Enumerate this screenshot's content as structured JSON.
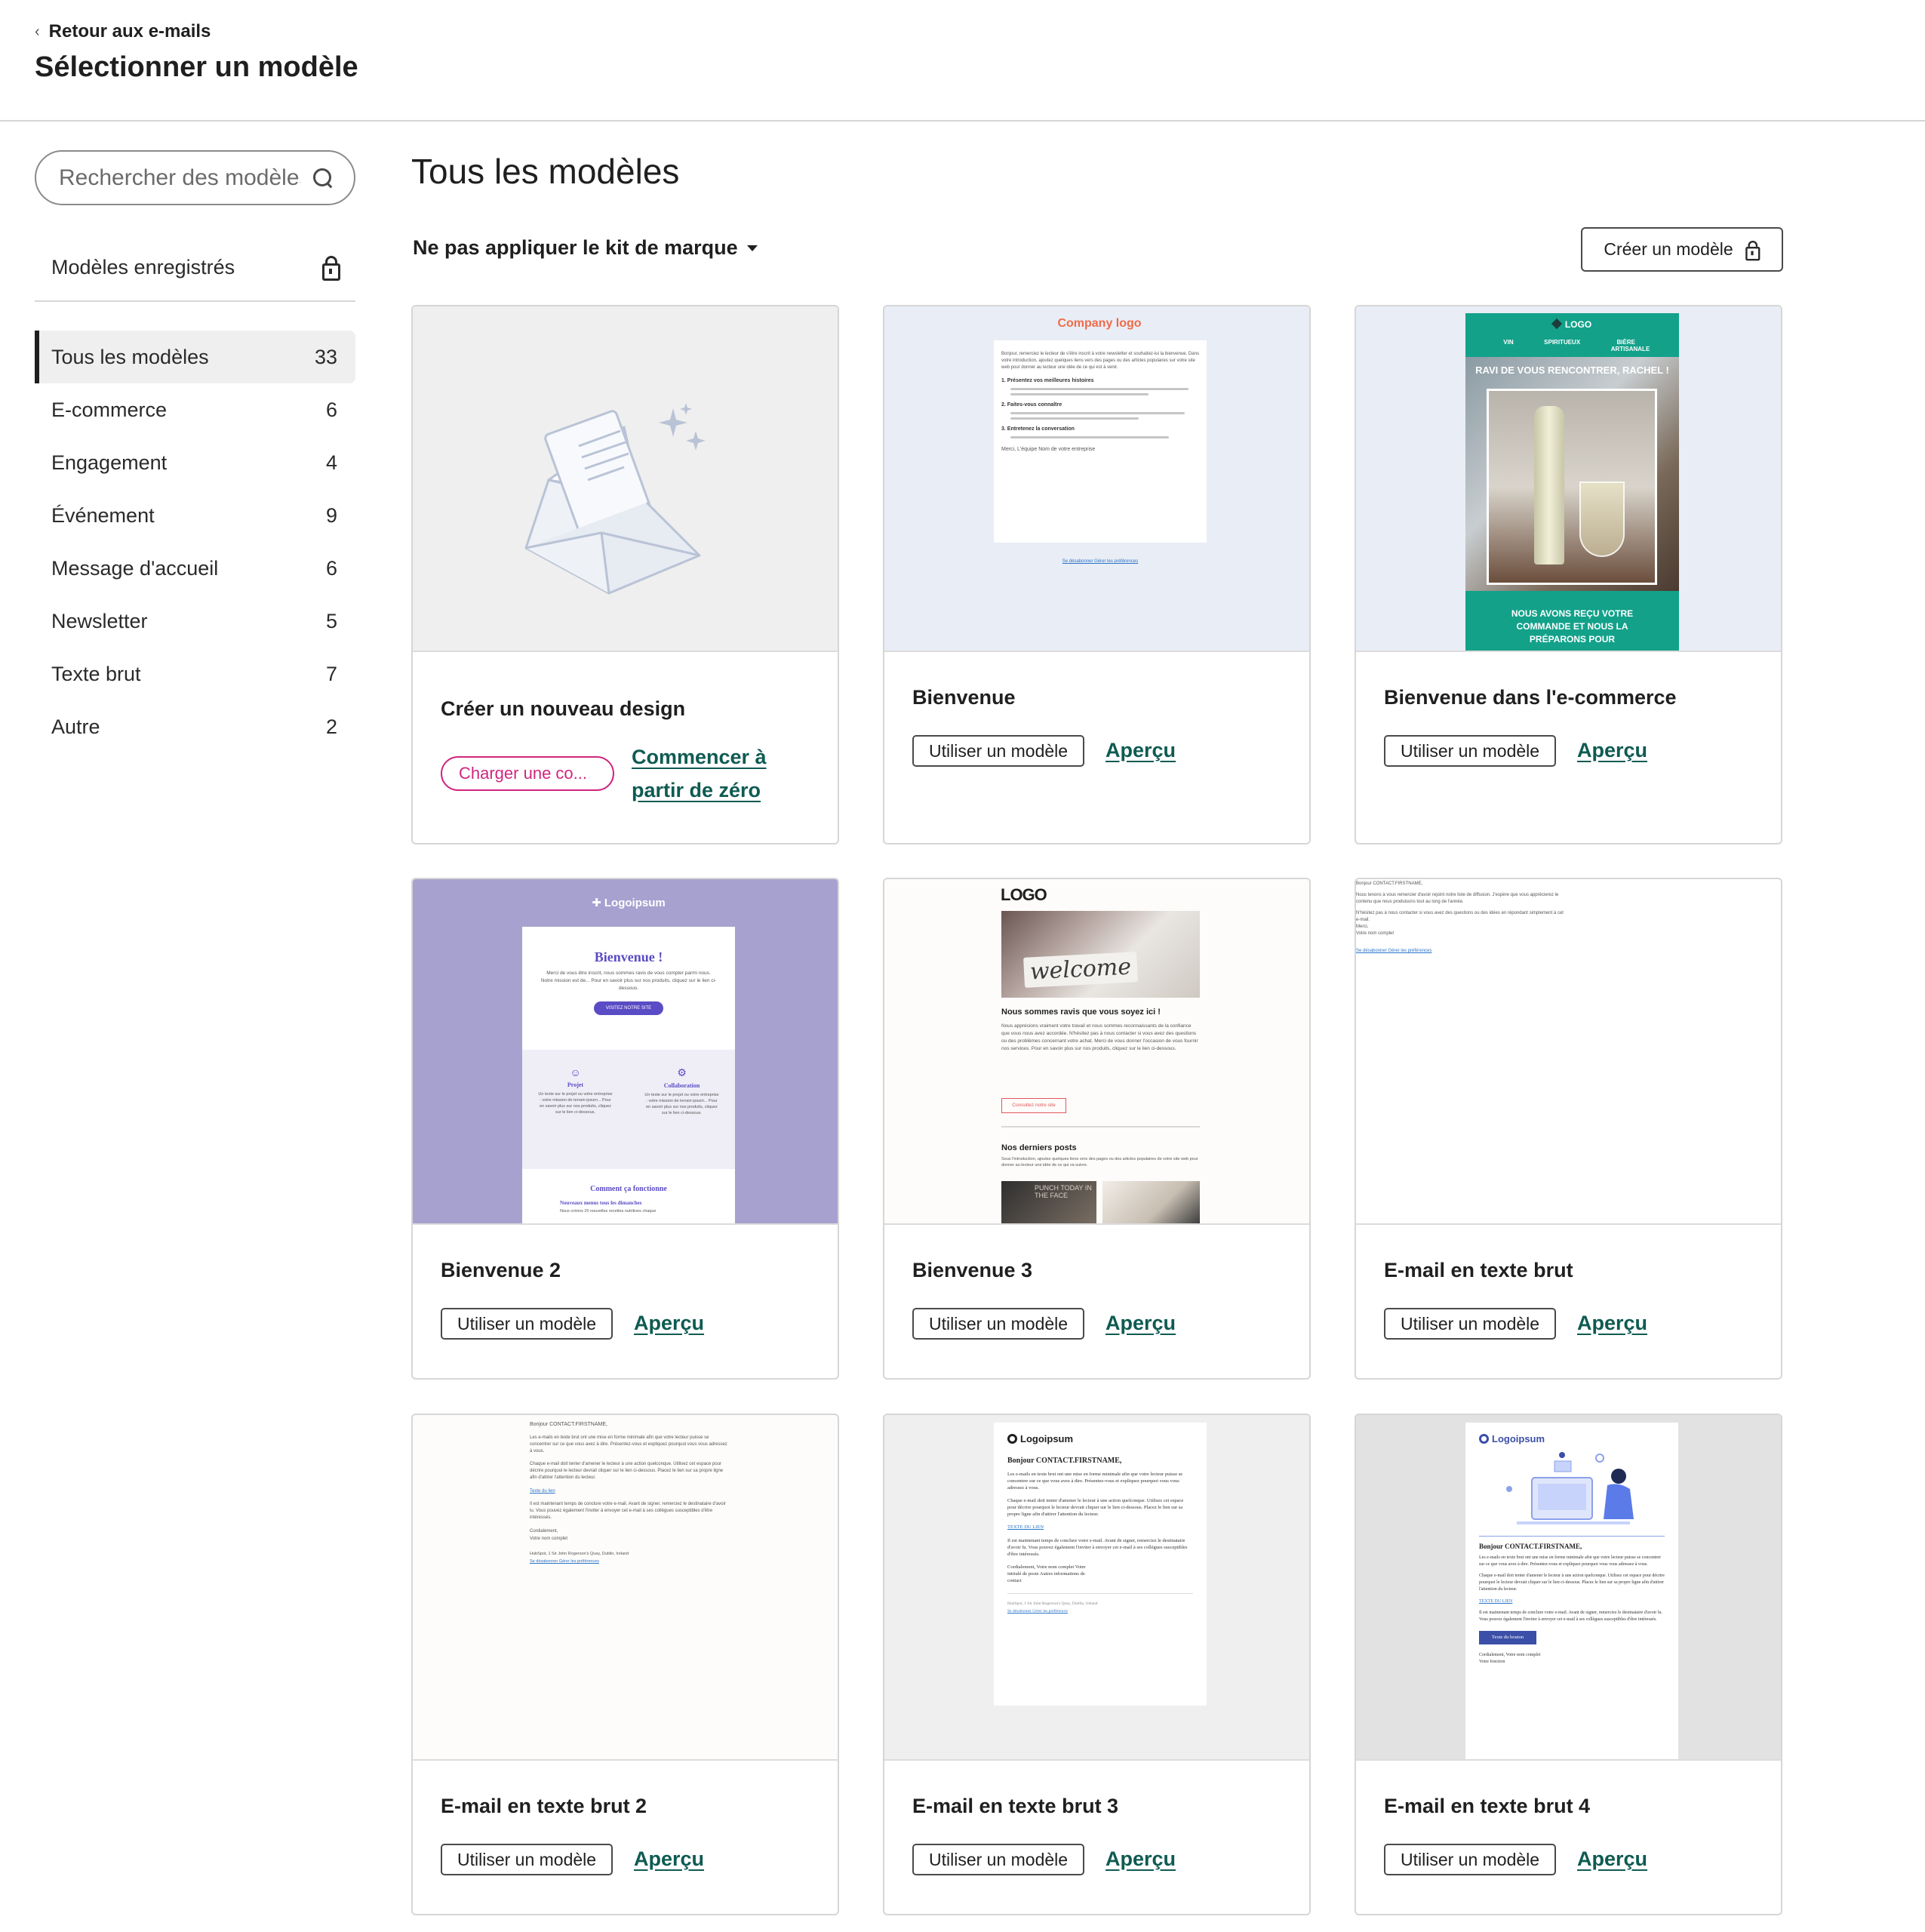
{
  "header": {
    "back_label": "Retour aux e-mails",
    "title": "Sélectionner un modèle"
  },
  "sidebar": {
    "search_placeholder": "Rechercher des modèles",
    "saved_label": "Modèles enregistrés",
    "categories": [
      {
        "label": "Tous les modèles",
        "count": "33"
      },
      {
        "label": "E-commerce",
        "count": "6"
      },
      {
        "label": "Engagement",
        "count": "4"
      },
      {
        "label": "Événement",
        "count": "9"
      },
      {
        "label": "Message d'accueil",
        "count": "6"
      },
      {
        "label": "Newsletter",
        "count": "5"
      },
      {
        "label": "Texte brut",
        "count": "7"
      },
      {
        "label": "Autre",
        "count": "2"
      }
    ]
  },
  "main": {
    "title": "Tous les modèles",
    "brand_kit_label": "Ne pas appliquer le kit de marque",
    "create_label": "Créer un modèle",
    "use_label": "Utiliser un modèle",
    "preview_label": "Aperçu",
    "new_card": {
      "title": "Créer un nouveau design",
      "upload_label": "Charger une co...",
      "scratch_label": "Commencer à partir de zéro"
    },
    "cards": [
      {
        "title": "Bienvenue"
      },
      {
        "title": "Bienvenue dans l'e-commerce"
      },
      {
        "title": "Bienvenue 2"
      },
      {
        "title": "Bienvenue 3"
      },
      {
        "title": "E-mail en texte brut"
      },
      {
        "title": "E-mail en texte brut 2"
      },
      {
        "title": "E-mail en texte brut 3"
      },
      {
        "title": "E-mail en texte brut 4"
      }
    ]
  },
  "thumbs": {
    "bienvenue": {
      "logo": "Company logo",
      "intro": "Bonjour, remerciez le lecteur de s'être inscrit à votre newsletter et souhaitez-lui la bienvenue. Dans votre introduction, ajoutez quelques liens vers des pages ou des articles populaires sur votre site web pour donner au lecteur une idée de ce qui est à venir.",
      "item1": "1. Présentez vos meilleures histoires",
      "item2": "2. Faites-vous connaître",
      "item3": "3. Entretenez la conversation",
      "sign": "Merci, L'équipe Nom de votre entreprise",
      "footer": "Se désabonner  Gérer les préférences"
    },
    "ecommerce": {
      "logo": "LOGO",
      "nav": [
        "VIN",
        "SPIRITUEUX",
        "BIÈRE ARTISANALE"
      ],
      "headline": "RAVI DE VOUS RENCONTRER, RACHEL !",
      "footer": "NOUS AVONS REÇU VOTRE COMMANDE ET NOUS LA PRÉPARONS POUR"
    },
    "bienvenue2": {
      "logo": "Logoipsum",
      "heading": "Bienvenue !",
      "body": "Merci de vous être inscrit, nous sommes ravis de vous compter parmi nous. Notre mission est de... Pour en savoir plus sur nos produits, cliquez sur le lien ci-dessous.",
      "button": "VISITEZ NOTRE SITE",
      "col1": "Projet",
      "col2": "Collaboration",
      "col_text": "Un texte sur le projet ou votre entreprise : votre mission de terrain ipsum... Pour en savoir plus sur nos produits, cliquez sur le lien ci-dessous.",
      "how": "Comment ça fonctionne",
      "step1": "Nouveaux menus tous les dimanches",
      "step1_sub": "Nous créons 20 nouvelles recettes nutritives chaque"
    },
    "bienvenue3": {
      "logo": "LOGO",
      "welcome": "welcome",
      "heading": "Nous sommes ravis que vous soyez ici !",
      "body": "Nous apprécions vraiment votre travail et nous sommes reconnaissants de la confiance que vous nous avez accordée. N'hésitez pas à nous contacter si vous avez des questions ou des problèmes concernant votre achat. Merci de vous donner l'occasion de vous fournir nos services. Pour en savoir plus sur nos produits, cliquez sur le lien ci-dessous.",
      "button": "Consultez notre site",
      "posts": "Nos derniers posts",
      "posts_body": "Sous l'introduction, ajoutez quelques liens vers des pages ou des articles populaires de votre site web pour donner au lecteur une idée de ce qui va suivre.",
      "punch": "PUNCH TODAY IN THE FACE"
    },
    "plain1": {
      "greeting": "Bonjour CONTACT.FIRSTNAME,",
      "l1": "Nous tenons à vous remercier d'avoir rejoint notre liste de diffusion. J'espère que vous apprécierez le contenu que nous produisons tout au long de l'année.",
      "l2": "N'hésitez pas à nous contacter si vous avez des questions ou des idées en répondant simplement à cet e-mail.",
      "l3": "Merci,",
      "l4": "Votre nom complet",
      "footer": "Se désabonner  Gérer les préférences"
    },
    "plain2": {
      "greeting": "Bonjour CONTACT.FIRSTNAME,",
      "p1": "Les e-mails en texte brut ont une mise en forme minimale afin que votre lecteur puisse se concentrer sur ce que vous avez à dire. Présentez-vous et expliquez pourquoi vous vous adressez à vous.",
      "p2": "Chaque e-mail doit tenter d'amener le lecteur à une action quelconque. Utilisez cet espace pour décrire pourquoi le lecteur devrait cliquer sur le lien ci-dessous. Placez le lien sur sa propre ligne afin d'attirer l'attention du lecteur.",
      "link": "Texte du lien",
      "p3": "Il est maintenant temps de conclure votre e-mail. Avant de signer, remerciez le destinataire d'avoir lu. Vous pouvez également l'inviter à envoyer cet e-mail à ses collègues susceptibles d'être intéressés.",
      "sign": "Cordialement,",
      "name": "Votre nom complet",
      "address": "HubSpot, 1 Sir John Rogerson's Quay, Dublin, Ireland",
      "footer": "Se désabonner  Gérer les préférences"
    },
    "plain3": {
      "logo": "Logoipsum",
      "greeting": "Bonjour CONTACT.FIRSTNAME,",
      "p1": "Les e-mails en texte brut ont une mise en forme minimale afin que votre lecteur puisse se concentrer sur ce que vous avez à dire. Présentez-vous et expliquez pourquoi vous vous adressez à vous.",
      "p2": "Chaque e-mail doit tenter d'amener le lecteur à une action quelconque. Utilisez cet espace pour décrire pourquoi le lecteur devrait cliquer sur le lien ci-dessous. Placez le lien sur sa propre ligne afin d'attirer l'attention du lecteur.",
      "link": "TEXTE DU LIEN",
      "p3": "Il est maintenant temps de conclure votre e-mail. Avant de signer, remerciez le destinataire d'avoir lu. Vous pouvez également l'inviter à envoyer cet e-mail à ses collègues susceptibles d'être intéressés.",
      "sign": "Cordialement, Votre nom complet Votre intitulé de poste Autres informations de contact",
      "address": "HubSpot, 1 Sir John Rogerson's Quay, Dublin, Ireland",
      "footer": "Se désabonner  Gérer les préférences"
    },
    "plain4": {
      "logo": "Logoipsum",
      "greeting": "Bonjour CONTACT.FIRSTNAME,",
      "p1": "Les e-mails en texte brut ont une mise en forme minimale afin que votre lecteur puisse se concentrer sur ce que vous avez à dire. Présentez-vous et expliquez pourquoi vous vous adressez à vous.",
      "p2": "Chaque e-mail doit tenter d'amener le lecteur à une action quelconque. Utilisez cet espace pour décrire pourquoi le lecteur devrait cliquer sur le lien ci-dessous. Placez le lien sur sa propre ligne afin d'attirer l'attention du lecteur.",
      "link": "TEXTE DU LIEN",
      "p3": "Il est maintenant temps de conclure votre e-mail. Avant de signer, remerciez le destinataire d'avoir lu. Vous pouvez également l'inviter à envoyer cet e-mail à ses collègues susceptibles d'être intéressés.",
      "button": "Texte du bouton",
      "sign": "Cordialement, Votre nom complet Votre fonction"
    }
  },
  "colors": {
    "accent_link": "#0f5b52",
    "upload_pink": "#d0267e",
    "teal_brand": "#13a18a",
    "lavender": "#a7a1d0",
    "purple": "#5a4cc4"
  }
}
